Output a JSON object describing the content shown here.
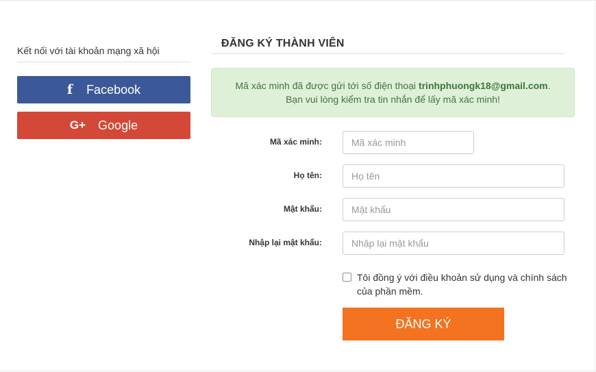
{
  "social": {
    "title": "Kết nối với tài khoản mạng xã hội",
    "facebook": {
      "icon": "f",
      "label": "Facebook",
      "color": "#3b5998"
    },
    "google": {
      "icon": "G+",
      "label": "Google",
      "color": "#d34836"
    }
  },
  "form": {
    "title": "ĐĂNG KÝ THÀNH VIÊN",
    "alert": {
      "line1_prefix": "Mã xác minh đã được gửi tới số điện thoại ",
      "email": "trinhphuongk18@gmail.com",
      "line1_suffix": ".",
      "line2": "Bạn vui lòng kiểm tra tin nhắn để lấy mã xác minh!"
    },
    "fields": {
      "code": {
        "label": "Mã xác minh:",
        "placeholder": "Mã xác minh"
      },
      "name": {
        "label": "Họ tên:",
        "placeholder": "Họ tên"
      },
      "password": {
        "label": "Mật khẩu:",
        "placeholder": "Mật khẩu"
      },
      "password_confirm": {
        "label": "Nhập lại mật khẩu:",
        "placeholder": "Nhập lại mật khẩu"
      }
    },
    "agree_text": "Tôi đồng ý với điều khoản sử dụng và chính sách của phần mềm.",
    "submit_label": "ĐĂNG KÝ",
    "submit_color": "#f47321"
  }
}
